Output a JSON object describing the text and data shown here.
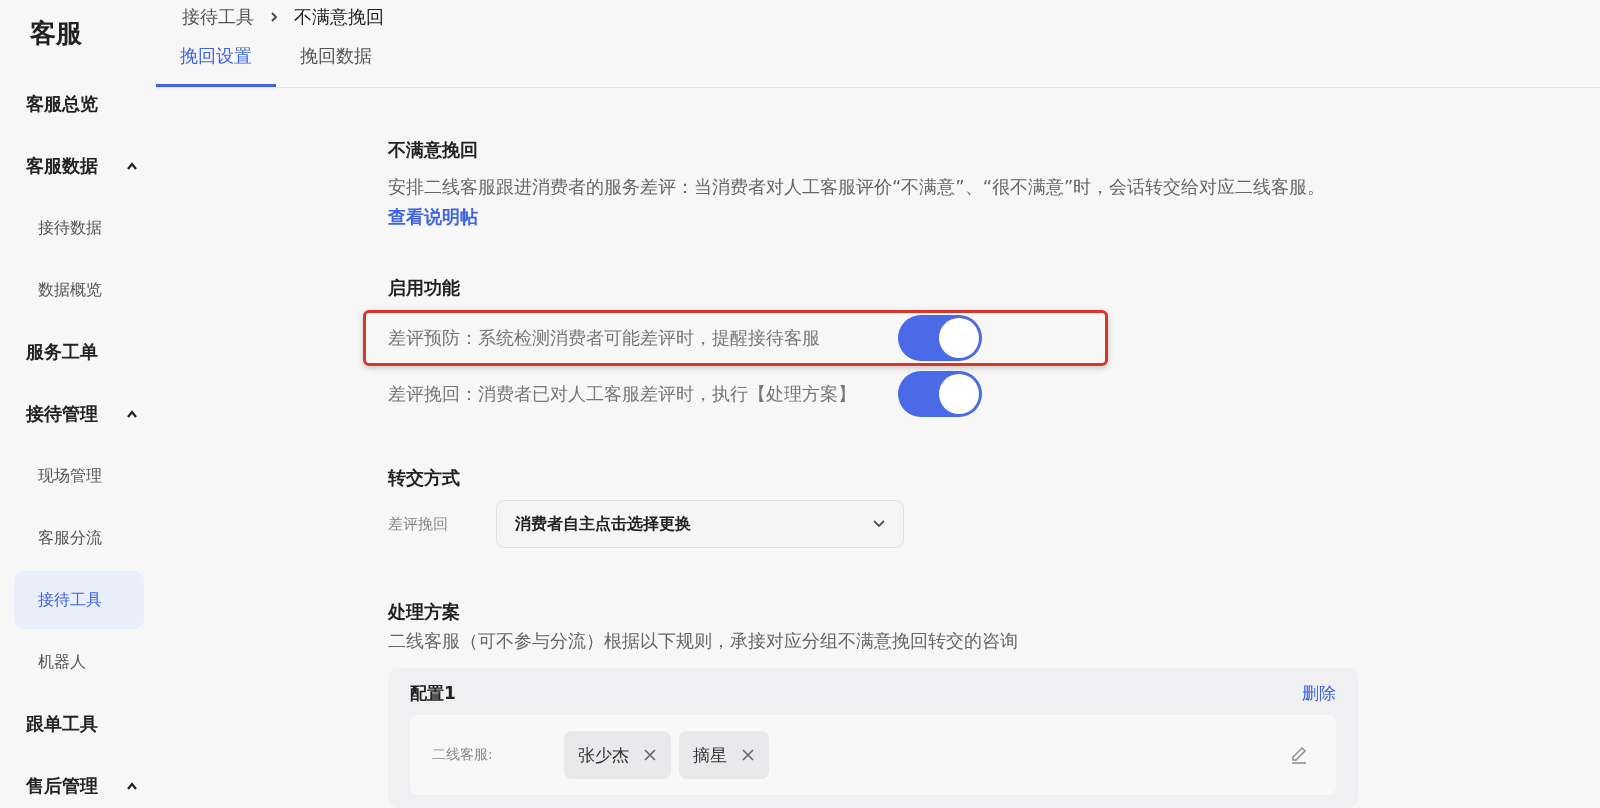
{
  "sidebar": {
    "title": "客服",
    "items": [
      {
        "label": "客服总览",
        "selected": false
      },
      {
        "label": "客服数据",
        "selected": false,
        "expanded": true,
        "children": [
          {
            "label": "接待数据",
            "selected": false
          },
          {
            "label": "数据概览",
            "selected": false
          }
        ]
      },
      {
        "label": "服务工单",
        "selected": false
      },
      {
        "label": "接待管理",
        "selected": false,
        "expanded": true,
        "children": [
          {
            "label": "现场管理",
            "selected": false
          },
          {
            "label": "客服分流",
            "selected": false
          },
          {
            "label": "接待工具",
            "selected": true
          },
          {
            "label": "机器人",
            "selected": false
          }
        ]
      },
      {
        "label": "跟单工具",
        "selected": false
      },
      {
        "label": "售后管理",
        "selected": false,
        "expanded": true
      }
    ]
  },
  "breadcrumb": [
    "接待工具",
    "不满意挽回"
  ],
  "tabs": [
    {
      "label": "挽回设置",
      "selected": true
    },
    {
      "label": "挽回数据",
      "selected": false
    }
  ],
  "section": {
    "title": "不满意挽回",
    "description": "安排二线客服跟进消费者的服务差评：当消费者对人工客服评价“不满意”、“很不满意”时，会话转交给对应二线客服。",
    "link": "查看说明帖"
  },
  "features": {
    "title": "启用功能",
    "rows": [
      {
        "label": "差评预防：系统检测消费者可能差评时，提醒接待客服",
        "on": true,
        "highlighted": true
      },
      {
        "label": "差评挽回：消费者已对人工客服差评时，执行【处理方案】",
        "on": true,
        "highlighted": false
      }
    ]
  },
  "transfer": {
    "title": "转交方式",
    "label": "差评挽回",
    "value": "消费者自主点击选择更换"
  },
  "plan": {
    "title": "处理方案",
    "description": "二线客服（可不参与分流）根据以下规则，承接对应分组不满意挽回转交的咨询",
    "configs": [
      {
        "name": "配置1",
        "delete": "删除",
        "field_label": "二线客服:",
        "tags": [
          "张少杰",
          "摘星"
        ]
      }
    ]
  }
}
